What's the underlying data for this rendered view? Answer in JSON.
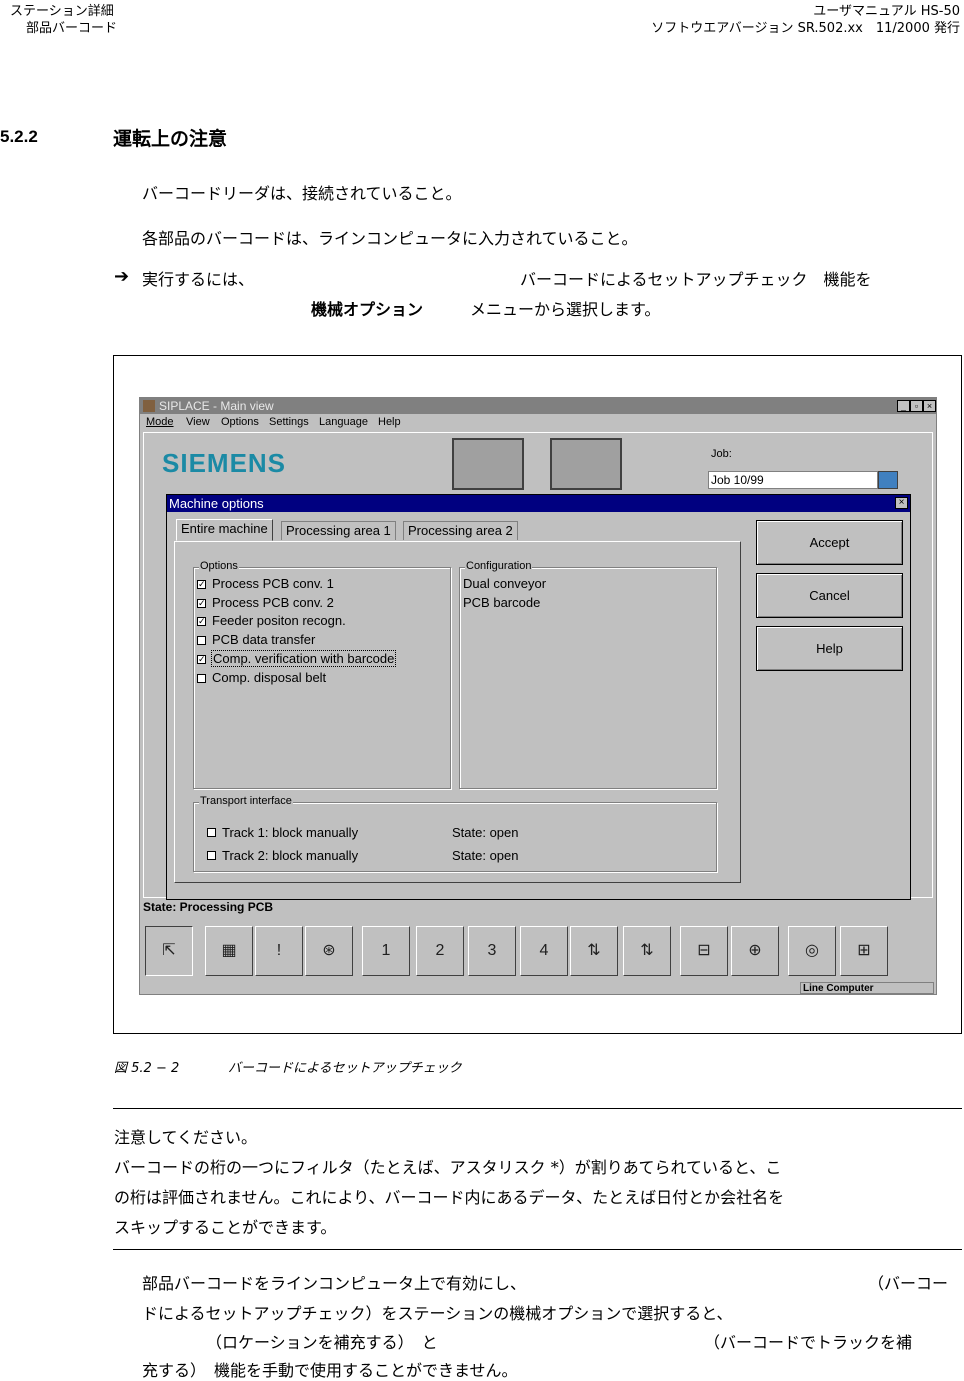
{
  "header": {
    "left_line1": "ステーション詳細",
    "left_line2": "部品バーコード",
    "right_line1": "ユーザマニュアル HS-50",
    "right_line2": "ソフトウエアバージョン SR.502.xx　11/2000 発行"
  },
  "section": {
    "number": "5.2.2",
    "title": "運転上の注意"
  },
  "intro": {
    "line1": "バーコードリーダは、接続されていること。",
    "line2": "各部品のバーコードは、ラインコンピュータに入力されていること。",
    "arrow": "➔",
    "line3a": "実行するには、",
    "line3b": "バーコードによるセットアップチェック　機能を",
    "line4a": "機械オプション",
    "line4b": "メニューから選択します。"
  },
  "app": {
    "title": "SIPLACE - Main view",
    "menu": [
      "Mode",
      "View",
      "Options",
      "Settings",
      "Language",
      "Help"
    ],
    "logo": "SIEMENS",
    "job_label": "Job:",
    "job_value": "Job 10/99",
    "state_text": "State:   Processing PCB",
    "status_field": "Line Computer",
    "toolbar_icons": [
      "select-icon",
      "component-table-icon",
      "alarm-icon",
      "feeder-reel-icon",
      "gantry-1-icon",
      "gantry-2-icon",
      "gantry-3-icon",
      "gantry-4-icon",
      "conveyor-2-icon",
      "conveyor-1-icon",
      "board-in-icon",
      "transport-icon",
      "mouse-icon",
      "network-icon"
    ]
  },
  "dialog": {
    "title": "Machine options",
    "tabs": [
      "Entire machine",
      "Processing area 1",
      "Processing area 2"
    ],
    "options_label": "Options",
    "options": [
      {
        "label": "Process PCB conv. 1",
        "checked": true
      },
      {
        "label": "Process PCB conv. 2",
        "checked": true
      },
      {
        "label": "Feeder positon recogn.",
        "checked": true
      },
      {
        "label": "PCB data transfer",
        "checked": false
      },
      {
        "label": "Comp. verification with barcode",
        "checked": true
      },
      {
        "label": "Comp. disposal belt",
        "checked": false
      }
    ],
    "config_label": "Configuration",
    "config": [
      "Dual conveyor",
      "PCB barcode"
    ],
    "transport_label": "Transport interface",
    "transport": [
      {
        "label": "Track 1: block manually",
        "state": "State: open"
      },
      {
        "label": "Track 2: block manually",
        "state": "State: open"
      }
    ],
    "buttons": [
      "Accept",
      "Cancel",
      "Help"
    ]
  },
  "caption": {
    "num": "図 5.2 − 2",
    "text": "バーコードによるセットアップチェック"
  },
  "note": {
    "line1": "注意してください。",
    "line2": "バーコードの桁の一つにフィルタ（たとえば、アスタリスク *）が割りあてられていると、こ",
    "line3": "の桁は評価されません。これにより、バーコード内にあるデータ、たとえば日付とか会社名を",
    "line4": "スキップすることができます。"
  },
  "final": {
    "line1a": "部品バーコードをラインコンピュータ上で有効にし、",
    "line1b": "（バーコー",
    "line2": "ドによるセットアップチェック）をステーションの機械オプションで選択すると、",
    "line3a": "（ロケーションを補充する）　と",
    "line3b": "（バーコードでトラックを補",
    "line4": "充する）　機能を手動で使用することができません。"
  }
}
